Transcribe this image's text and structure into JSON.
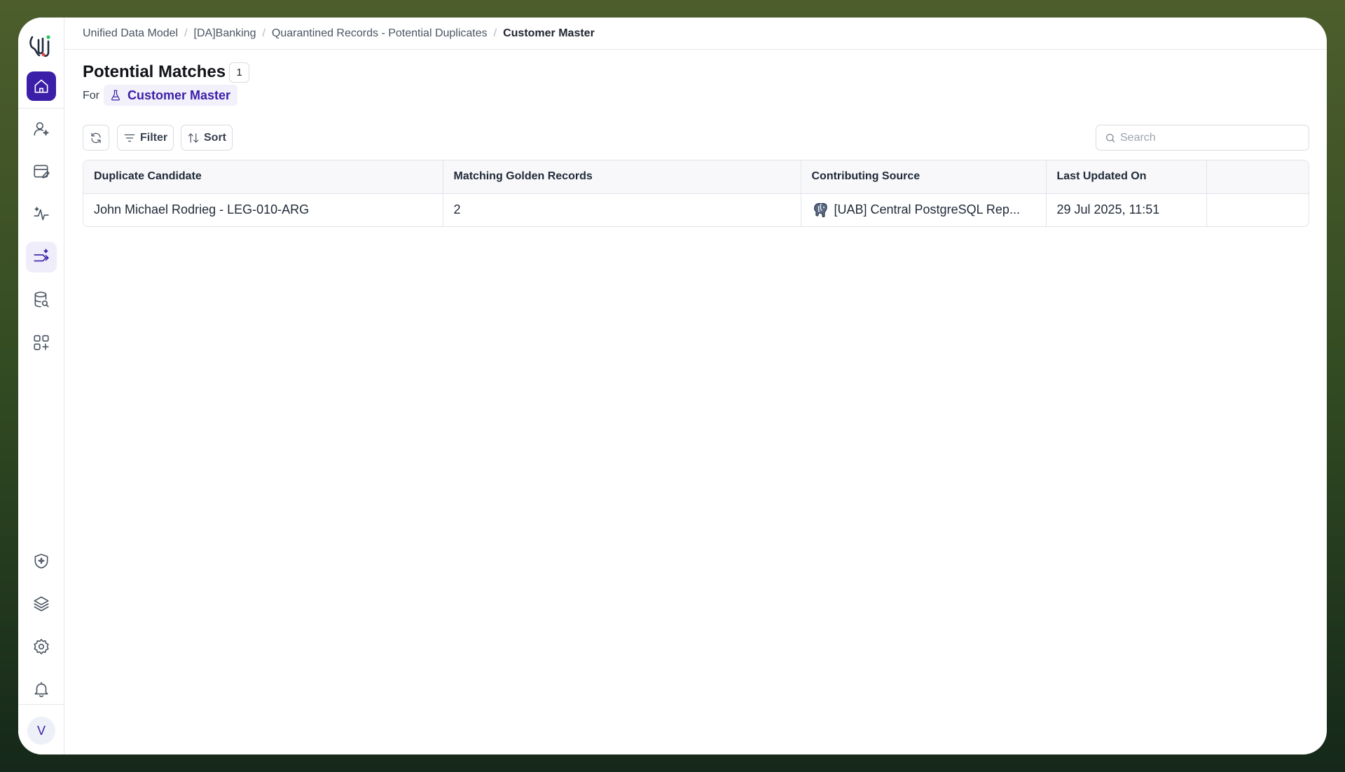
{
  "breadcrumb": [
    "Unified Data Model",
    "[DA]Banking",
    "Quarantined Records - Potential Duplicates"
  ],
  "breadcrumb_current": "Customer Master",
  "page": {
    "title": "Potential Matches",
    "count": "1",
    "for_label": "For",
    "entity": "Customer Master"
  },
  "toolbar": {
    "filter_label": "Filter",
    "sort_label": "Sort",
    "search_placeholder": "Search"
  },
  "table": {
    "headers": [
      "Duplicate Candidate",
      "Matching Golden Records",
      "Contributing Source",
      "Last Updated On",
      ""
    ],
    "rows": [
      {
        "candidate": "John Michael Rodrieg - LEG-010-ARG",
        "matching": "2",
        "source": "[UAB] Central PostgreSQL Rep...",
        "updated": "29 Jul 2025, 11:51"
      }
    ]
  },
  "user": {
    "initial": "V"
  },
  "colors": {
    "accent": "#3b1fa8",
    "accent_soft": "#efedfa"
  },
  "sidebar_icons": [
    "home-icon",
    "user-sparkle-icon",
    "data-edit-icon",
    "activity-sparkle-icon",
    "merge-sparkle-icon",
    "database-search-icon",
    "apps-add-icon",
    "shield-sparkle-icon",
    "layers-icon",
    "gear-icon",
    "bell-icon"
  ]
}
